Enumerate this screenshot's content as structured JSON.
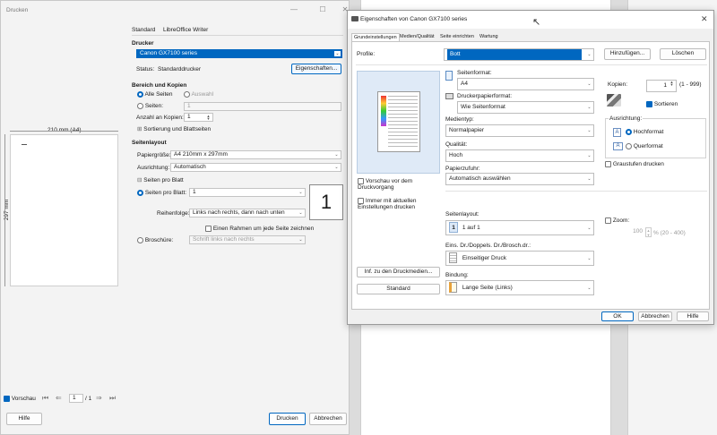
{
  "print": {
    "title": "Drucken",
    "tabs": [
      "Standard",
      "LibreOffice Writer"
    ],
    "printer_header": "Drucker",
    "printer_selected": "Canon GX7100 series",
    "status_label": "Status:",
    "status_value": "Standarddrucker",
    "properties_button": "Eigenschaften...",
    "range_header": "Bereich und Kopien",
    "all_pages": "Alle Seiten",
    "selection": "Auswahl",
    "pages_label": "Seiten:",
    "pages_value": "1",
    "copies_label": "Anzahl an Kopien:",
    "copies_value": "1",
    "collate": "Sortierung und Blattseiten",
    "layout_header": "Seitenlayout",
    "paper_size_label": "Papiergröße:",
    "paper_size_value": "A4 210mm x 297mm",
    "orientation_label": "Ausrichtung:",
    "orientation_value": "Automatisch",
    "pages_per_sheet_section": "Seiten pro Blatt",
    "pages_per_sheet_label": "Seiten pro Blatt:",
    "pages_per_sheet_value": "1",
    "big_number": "1",
    "order_label": "Reihenfolge:",
    "order_value": "Links nach rechts, dann nach unten",
    "border_label": "Einen Rahmen um jede Seite zeichnen",
    "brochure_label": "Broschüre:",
    "brochure_value": "Schrift links nach rechts",
    "page_width": "210 mm (A4)",
    "page_height": "297 mm",
    "preview_label": "Vorschau",
    "page_current": "1",
    "page_total": "/ 1",
    "help_button": "Hilfe",
    "print_button": "Drucken",
    "cancel_button": "Abbrechen"
  },
  "canon": {
    "title": "Eigenschaften von Canon GX7100 series",
    "tabs": [
      "Grundeinstellungen",
      "Medien/Qualität",
      "Seite einrichten",
      "Wartung"
    ],
    "profile_label": "Profile:",
    "profile_value": "Bott",
    "add_button": "Hinzufügen...",
    "delete_button": "Löschen",
    "page_size_label": "Seitenformat:",
    "page_size_value": "A4",
    "paper_format_label": "Druckerpapierformat:",
    "paper_format_value": "Wie Seitenformat",
    "media_type_label": "Medientyp:",
    "media_type_value": "Normalpapier",
    "quality_label": "Qualität:",
    "quality_value": "Hoch",
    "paper_source_label": "Papierzufuhr:",
    "paper_source_value": "Automatisch auswählen",
    "copies_label": "Kopien:",
    "copies_value": "1",
    "copies_range": "(1 - 999)",
    "sort_label": "Sortieren",
    "orientation_label": "Ausrichtung:",
    "portrait": "Hochformat",
    "landscape": "Querformat",
    "grayscale": "Graustufen drucken",
    "preview_before": "Vorschau vor dem Druckvorgang",
    "keep_settings": "Immer mit aktuellen Einstellungen drucken",
    "layout_label": "Seitenlayout:",
    "layout_value": "1 auf 1",
    "layout_icon_text": "1",
    "zoom_label": "Zoom:",
    "zoom_value": "100",
    "zoom_range": "% (20 - 400)",
    "duplex_label": "Eins. Dr./Doppels. Dr./Brosch.dr.:",
    "duplex_value": "Einseitiger Druck",
    "binding_label": "Bindung:",
    "binding_value": "Lange Seite (Links)",
    "media_info_button": "Inf. zu den Druckmedien...",
    "standard_button": "Standard",
    "ok_button": "OK",
    "cancel_button": "Abbrechen",
    "help_button": "Hilfe",
    "accent": "#0067c0"
  }
}
